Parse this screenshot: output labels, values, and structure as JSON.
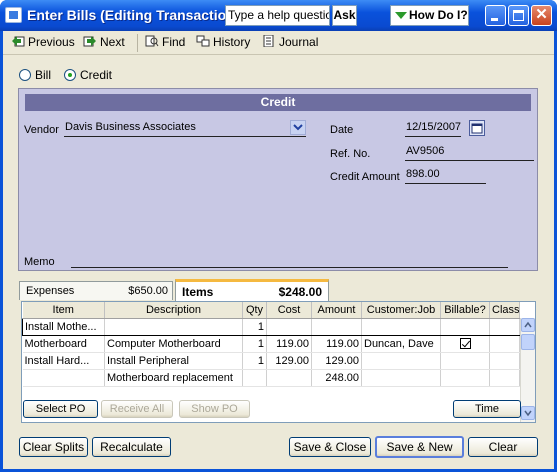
{
  "window": {
    "title": "Enter Bills (Editing Transaction...",
    "help_placeholder": "Type a help question",
    "ask_label": "Ask",
    "how_do_i_label": "How Do I?"
  },
  "toolbar": {
    "previous": "Previous",
    "next": "Next",
    "find": "Find",
    "history": "History",
    "journal": "Journal"
  },
  "mode": {
    "bill_label": "Bill",
    "credit_label": "Credit",
    "selected": "Credit"
  },
  "form": {
    "header": "Credit",
    "vendor_label": "Vendor",
    "vendor_value": "Davis Business Associates",
    "date_label": "Date",
    "date_value": "12/15/2007",
    "ref_label": "Ref. No.",
    "ref_value": "AV9506",
    "amount_label": "Credit Amount",
    "amount_value": "898.00",
    "memo_label": "Memo",
    "memo_value": ""
  },
  "tabs": {
    "expenses_label": "Expenses",
    "expenses_amount": "$650.00",
    "items_label": "Items",
    "items_amount": "$248.00"
  },
  "grid": {
    "columns": [
      "Item",
      "Description",
      "Qty",
      "Cost",
      "Amount",
      "Customer:Job",
      "Billable?",
      "Class"
    ],
    "rows": [
      {
        "item": "Install Mothe...",
        "description": "",
        "qty": "1",
        "cost": "",
        "amount": "",
        "customer": "",
        "billable": false,
        "class": ""
      },
      {
        "item": "Motherboard",
        "description": "Computer Motherboard",
        "qty": "1",
        "cost": "119.00",
        "amount": "119.00",
        "customer": "Duncan, Dave",
        "billable": true,
        "class": ""
      },
      {
        "item": "Install Hard...",
        "description": "Install Peripheral",
        "qty": "1",
        "cost": "129.00",
        "amount": "129.00",
        "customer": "",
        "billable": false,
        "class": ""
      },
      {
        "item": "",
        "description": "Motherboard replacement",
        "qty": "",
        "cost": "",
        "amount": "248.00",
        "customer": "",
        "billable": false,
        "class": ""
      }
    ]
  },
  "buttons": {
    "select_po": "Select PO",
    "receive_all": "Receive All",
    "show_po": "Show PO",
    "time": "Time",
    "clear_splits": "Clear Splits",
    "recalculate": "Recalculate",
    "save_close": "Save & Close",
    "save_new": "Save & New",
    "clear": "Clear"
  }
}
